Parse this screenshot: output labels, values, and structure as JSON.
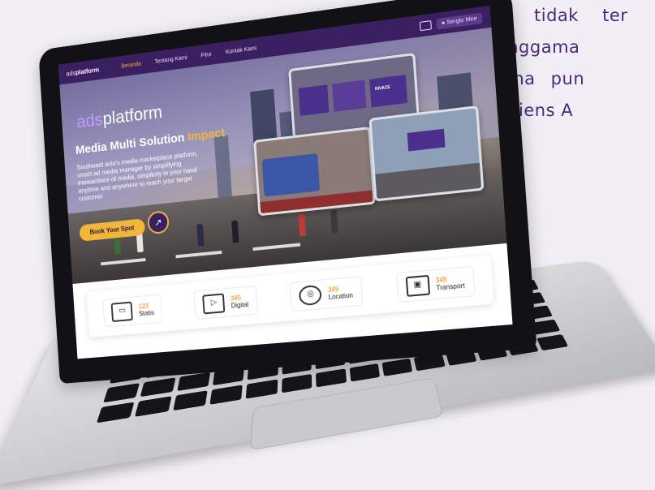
{
  "side_text": {
    "line1": "tidak ter",
    "line2": "genggama",
    "line3": "mana pun",
    "line4": "audiens A"
  },
  "nav": {
    "logo_prefix": "ads",
    "logo_brand": "platform",
    "items": [
      {
        "label": "Beranda",
        "active": true
      },
      {
        "label": "Tentang Kami",
        "active": false
      },
      {
        "label": "Fitur",
        "active": false
      },
      {
        "label": "Kontak Kami",
        "active": false
      }
    ],
    "user_label": "Sergio Mee"
  },
  "hero": {
    "logo_prefix": "ads",
    "logo_brand": "platform",
    "title_main": "Media Multi Solution",
    "title_accent": "Impact",
    "description": "Southeast asia's media marketplace platform, smart ad media manager by simplifying transactions of media, simplicity in your hand anytime and anywhere to reach your target customer",
    "cta_label": "Book Your Spot",
    "cta_arrow": "↗",
    "billboard_text": "INVACE"
  },
  "stats": [
    {
      "icon": "monitor-icon",
      "glyph": "▭",
      "value": "123",
      "label": "Statis"
    },
    {
      "icon": "digital-screen-icon",
      "glyph": "▷",
      "value": "345",
      "label": "Digital"
    },
    {
      "icon": "location-pin-icon",
      "glyph": "◎",
      "value": "345",
      "label": "Location"
    },
    {
      "icon": "bus-icon",
      "glyph": "▣",
      "value": "345",
      "label": "Transport"
    }
  ],
  "colors": {
    "nav_bg": "#3a1f61",
    "accent": "#f2b63a",
    "brand_purple": "#c49bff"
  }
}
